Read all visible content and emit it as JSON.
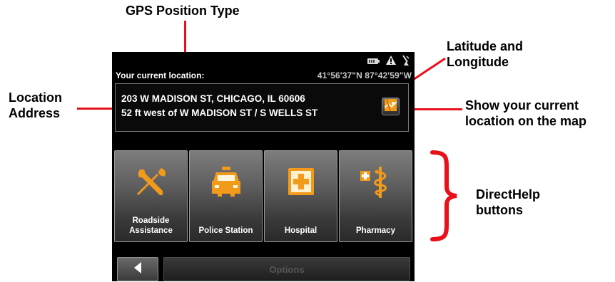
{
  "annotations": {
    "gps_position_type": "GPS Position Type",
    "latitude_longitude": [
      "Latitude and",
      "Longitude"
    ],
    "location_address": [
      "Location",
      "Address"
    ],
    "show_on_map": [
      "Show your current",
      "location on the map"
    ],
    "directhelp_buttons": [
      "DirectHelp",
      "buttons"
    ]
  },
  "colors": {
    "callout_line": "#e8101a",
    "brace": "#e8101a",
    "icon_orange": "#f29a1a",
    "screen_background": "#000000"
  },
  "status_icons": [
    "battery-icon",
    "warning-icon",
    "gps-satellite-icon"
  ],
  "location": {
    "label": "Your current location:",
    "coordinates": "41°56'37\"N  87°42'59\"W",
    "address_line1": "203 W MADISON ST, CHICAGO, IL 60606",
    "address_line2": "52 ft west of W MADISON ST / S WELLS ST",
    "map_button_icon": "map-icon"
  },
  "directhelp": [
    {
      "label": "Roadside\nAssistance",
      "icon": "wrench-screwdriver-icon"
    },
    {
      "label": "Police Station",
      "icon": "police-car-icon"
    },
    {
      "label": "Hospital",
      "icon": "hospital-cross-icon"
    },
    {
      "label": "Pharmacy",
      "icon": "pharmacy-icon"
    }
  ],
  "footer": {
    "back_icon": "back-arrow-icon",
    "options_label": "Options"
  }
}
